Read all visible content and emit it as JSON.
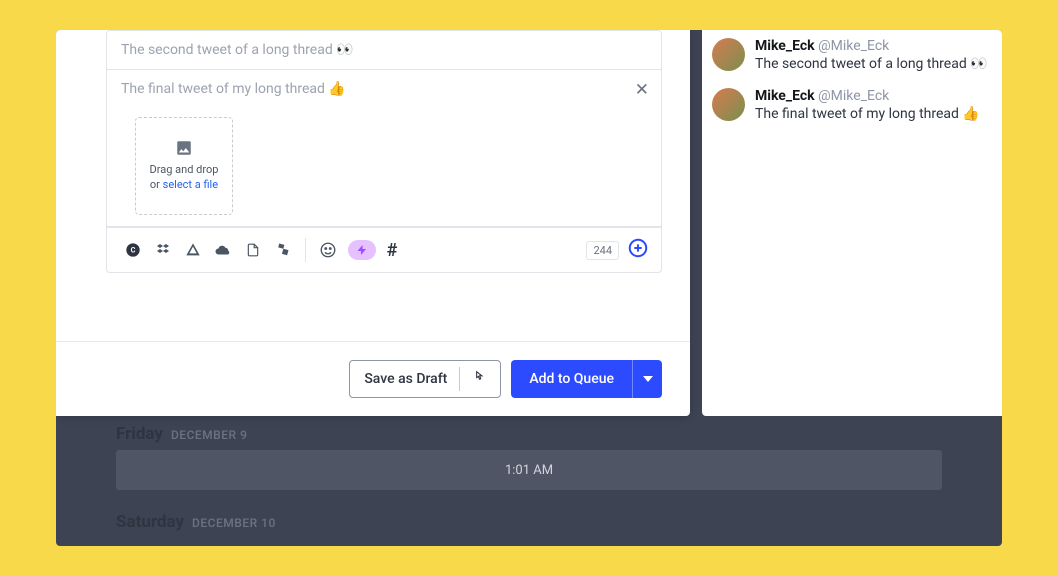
{
  "composer": {
    "tweets": [
      {
        "text": "The second tweet of a long thread 👀"
      },
      {
        "text": "The final tweet of my long thread 👍"
      }
    ],
    "dropzone": {
      "line1": "Drag and drop",
      "line2_prefix": "or ",
      "select_link": "select a file"
    },
    "char_count": "244",
    "buttons": {
      "save_draft": "Save as Draft",
      "add_queue": "Add to Queue"
    }
  },
  "preview": {
    "author_name": "Mike_Eck",
    "author_handle": "@Mike_Eck",
    "tweets": [
      {
        "text": "The second tweet of a long thread 👀"
      },
      {
        "text": "The final tweet of my long thread 👍"
      }
    ]
  },
  "calendar": {
    "days": [
      {
        "name": "Friday",
        "date": "DECEMBER 9",
        "slot": "1:01 AM"
      },
      {
        "name": "Saturday",
        "date": "DECEMBER 10",
        "slot": ""
      }
    ]
  }
}
